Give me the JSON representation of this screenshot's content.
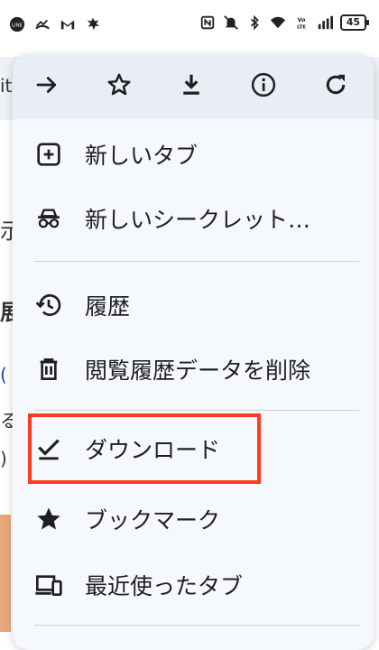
{
  "status_bar": {
    "left_icons": [
      "line-app-icon",
      "missed-call-icon",
      "gmail-icon",
      "gear-leaf-icon"
    ],
    "right_icons": [
      "nfc-icon",
      "mute-icon",
      "bluetooth-icon",
      "wifi-icon",
      "volte-icon",
      "signal-icon"
    ],
    "battery": "45"
  },
  "background_page": {
    "fragments": [
      "it",
      "示",
      "展",
      "(",
      "る",
      ")"
    ]
  },
  "menu": {
    "toolbar": [
      "forward-icon",
      "bookmark-star-icon",
      "download-icon",
      "info-icon",
      "refresh-icon"
    ],
    "items": [
      {
        "icon": "new-tab-icon",
        "label": "新しいタブ"
      },
      {
        "icon": "incognito-icon",
        "label": "新しいシークレット…"
      },
      {
        "icon": "history-icon",
        "label": "履歴"
      },
      {
        "icon": "trash-icon",
        "label": "閲覧履歴データを削除"
      },
      {
        "icon": "downloads-icon",
        "label": "ダウンロード"
      },
      {
        "icon": "bookmarks-star-icon",
        "label": "ブックマーク"
      },
      {
        "icon": "recent-tabs-icon",
        "label": "最近使ったタブ"
      }
    ]
  },
  "colors": {
    "menu_bg": "#f5f8fd",
    "toolbar_bg": "#e9eef6",
    "highlight": "#ff3b1f"
  }
}
